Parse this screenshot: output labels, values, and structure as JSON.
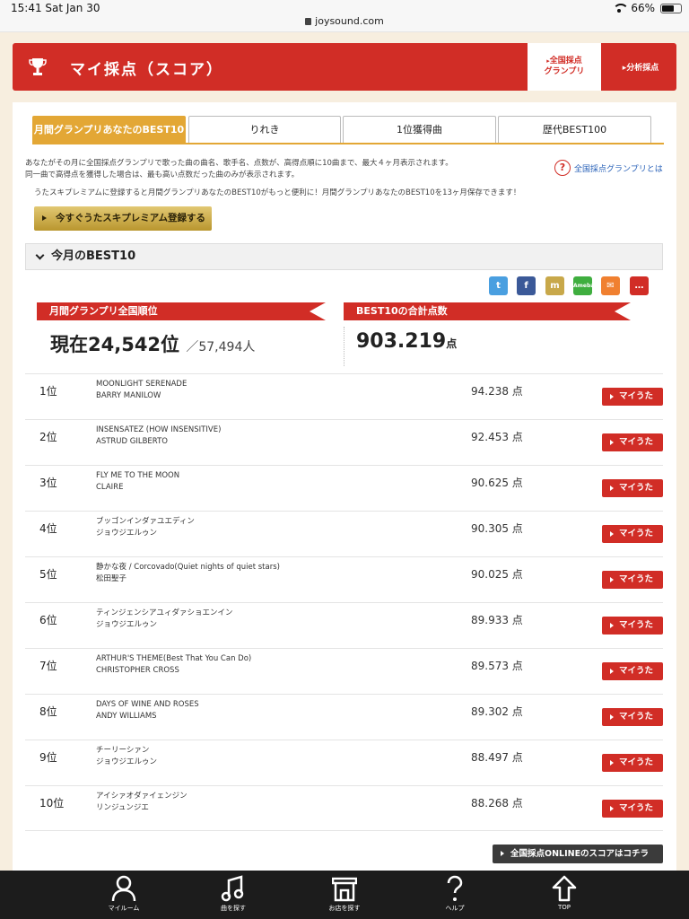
{
  "status": {
    "time": "15:41  Sat Jan 30",
    "url": "joysound.com",
    "battery": "66%",
    "battery_level": 0.66
  },
  "header": {
    "title": "マイ採点（スコア）",
    "zenkoku_line1": "全国採点",
    "zenkoku_line2": "グランプリ",
    "bunseki": "分析採点"
  },
  "tabs": [
    "月間グランプリあなたのBEST10",
    "りれき",
    "1位獲得曲",
    "歴代BEST100"
  ],
  "desc": {
    "line1": "あなたがその月に全国採点グランプリで歌った曲の曲名、歌手名、点数が、高得点順に10曲まで、最大４ヶ月表示されます。",
    "line2": "同一曲で高得点を獲得した場合は、最も高い点数だった曲のみが表示されます。",
    "line3": "うたスキプレミアムに登録すると月間グランプリあなたのBEST10がもっと便利に！月間グランプリあなたのBEST10を13ヶ月保存できます！",
    "help": "全国採点グランプリとは"
  },
  "premium_button": "今すぐうたスキプレミアム登録する",
  "section_title": "今月のBEST10",
  "share_icons": [
    {
      "name": "twitter-icon",
      "color": "#4a9fe0",
      "glyph": "t"
    },
    {
      "name": "facebook-icon",
      "color": "#3b5998",
      "glyph": "f"
    },
    {
      "name": "mixi-icon",
      "color": "#c8a84a",
      "glyph": "m"
    },
    {
      "name": "ameba-icon",
      "color": "#3fae3f",
      "glyph": "Ameba"
    },
    {
      "name": "mail-icon",
      "color": "#f08030",
      "glyph": "✉"
    },
    {
      "name": "message-icon",
      "color": "#d12d26",
      "glyph": "…"
    }
  ],
  "ranking": {
    "label": "月間グランプリ全国順位",
    "prefix": "現在",
    "value": "24,542",
    "suffix": "位",
    "total": "／57,494人"
  },
  "total_score": {
    "label": "BEST10の合計点数",
    "value": "903.219",
    "unit": "点"
  },
  "songs": [
    {
      "rank": "1位",
      "title": "MOONLIGHT SERENADE",
      "artist": "BARRY MANILOW",
      "score": "94.238 点",
      "button": "マイうた"
    },
    {
      "rank": "2位",
      "title": "INSENSATEZ (HOW INSENSITIVE)",
      "artist": "ASTRUD GILBERTO",
      "score": "92.453 点",
      "button": "マイうた"
    },
    {
      "rank": "3位",
      "title": "FLY ME TO THE MOON",
      "artist": "CLAIRE",
      "score": "90.625 点",
      "button": "マイうた"
    },
    {
      "rank": "4位",
      "title": "ブッゴンインダァユエディン",
      "artist": "ジョウジエルゥン",
      "score": "90.305 点",
      "button": "マイうた"
    },
    {
      "rank": "5位",
      "title": "静かな夜 / Corcovado(Quiet nights of quiet stars)",
      "artist": "松田聖子",
      "score": "90.025 点",
      "button": "マイうた"
    },
    {
      "rank": "6位",
      "title": "ティンジェンシアユィダァショエンイン",
      "artist": "ジョウジエルゥン",
      "score": "89.933 点",
      "button": "マイうた"
    },
    {
      "rank": "7位",
      "title": "ARTHUR'S THEME(Best That You Can Do)",
      "artist": "CHRISTOPHER CROSS",
      "score": "89.573 点",
      "button": "マイうた"
    },
    {
      "rank": "8位",
      "title": "DAYS OF WINE AND ROSES",
      "artist": "ANDY WILLIAMS",
      "score": "89.302 点",
      "button": "マイうた"
    },
    {
      "rank": "9位",
      "title": "チーリーシァン",
      "artist": "ジョウジエルゥン",
      "score": "88.497 点",
      "button": "マイうた"
    },
    {
      "rank": "10位",
      "title": "アイシァオダァイェンジン",
      "artist": "リンジュンジエ",
      "score": "88.268 点",
      "button": "マイうた"
    }
  ],
  "online_button": "全国採点ONLINEのスコアはコチラ",
  "bottom_nav": [
    {
      "label": "マイルーム",
      "icon": "person-icon"
    },
    {
      "label": "曲を探す",
      "icon": "music-note-icon"
    },
    {
      "label": "お店を探す",
      "icon": "shop-icon"
    },
    {
      "label": "ヘルプ",
      "icon": "help-icon"
    },
    {
      "label": "TOP",
      "icon": "home-icon"
    }
  ],
  "colors": {
    "brand_red": "#d12d26",
    "tab_gold": "#e3a735",
    "page_bg": "#f7eedf"
  }
}
